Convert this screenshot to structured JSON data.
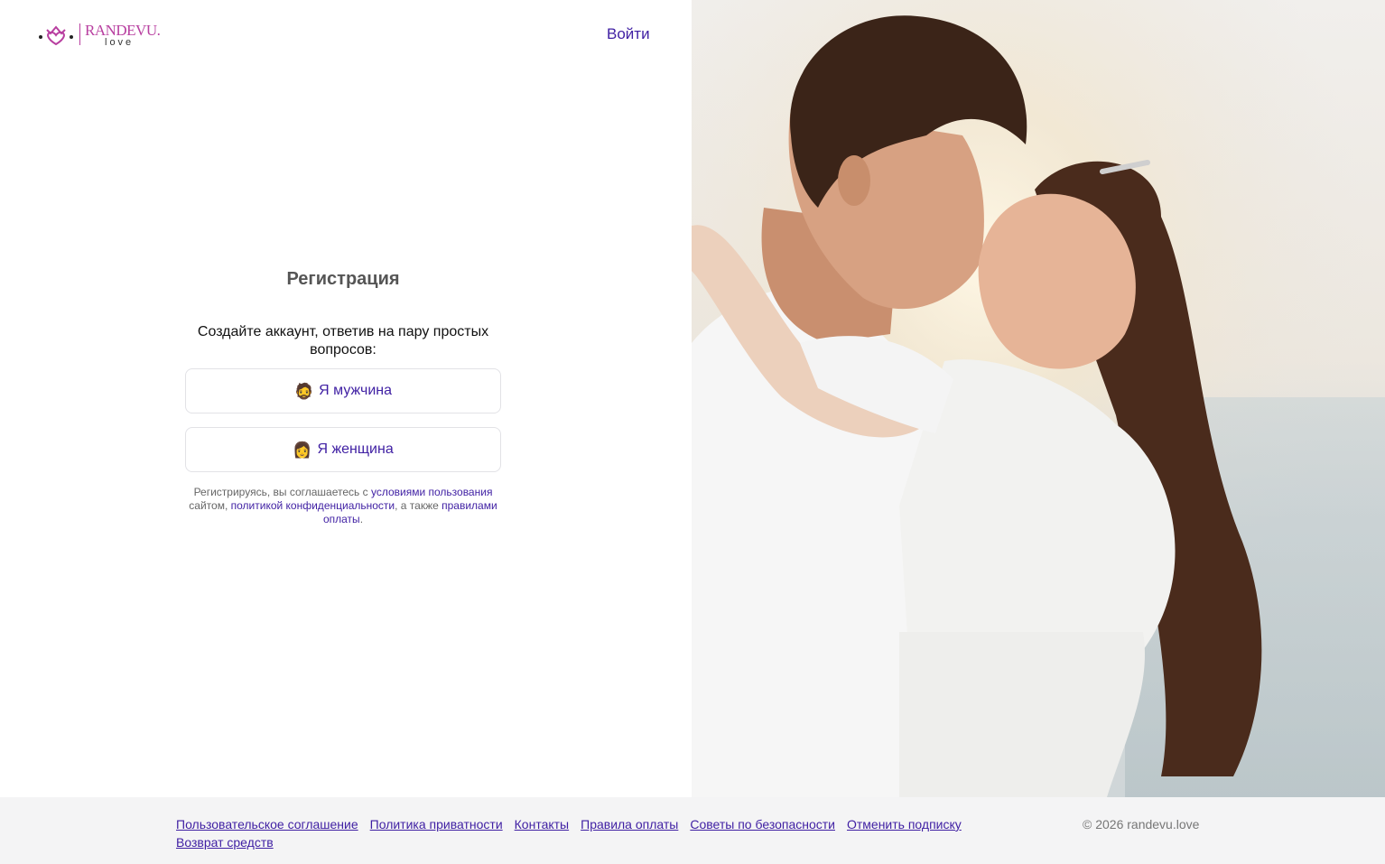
{
  "header": {
    "brand": "RANDEVU.",
    "brand_sub": "love",
    "login_label": "Войти"
  },
  "registration": {
    "title": "Регистрация",
    "subtitle": "Создайте аккаунт, ответив на пару простых вопросов:",
    "man_emoji": "🧔",
    "man_label": "Я мужчина",
    "woman_emoji": "👩",
    "woman_label": "Я женщина",
    "terms": {
      "part1": "Регистрируясь, вы соглашаетесь с ",
      "link_terms": "условиями пользования",
      "part2": " сайтом, ",
      "link_privacy": "политикой конфиденциальности",
      "part3": ", а также ",
      "link_payment": "правилами оплаты",
      "part4": "."
    }
  },
  "footer": {
    "links": [
      "Пользовательское соглашение",
      "Политика приватности",
      "Контакты",
      "Правила оплаты",
      "Советы по безопасности",
      "Отменить подписку",
      "Возврат средств"
    ],
    "copyright": "© 2026 randevu.love"
  },
  "colors": {
    "accent": "#3f1fa3",
    "brand": "#b83fa0",
    "footer_bg": "#f4f4f5"
  }
}
